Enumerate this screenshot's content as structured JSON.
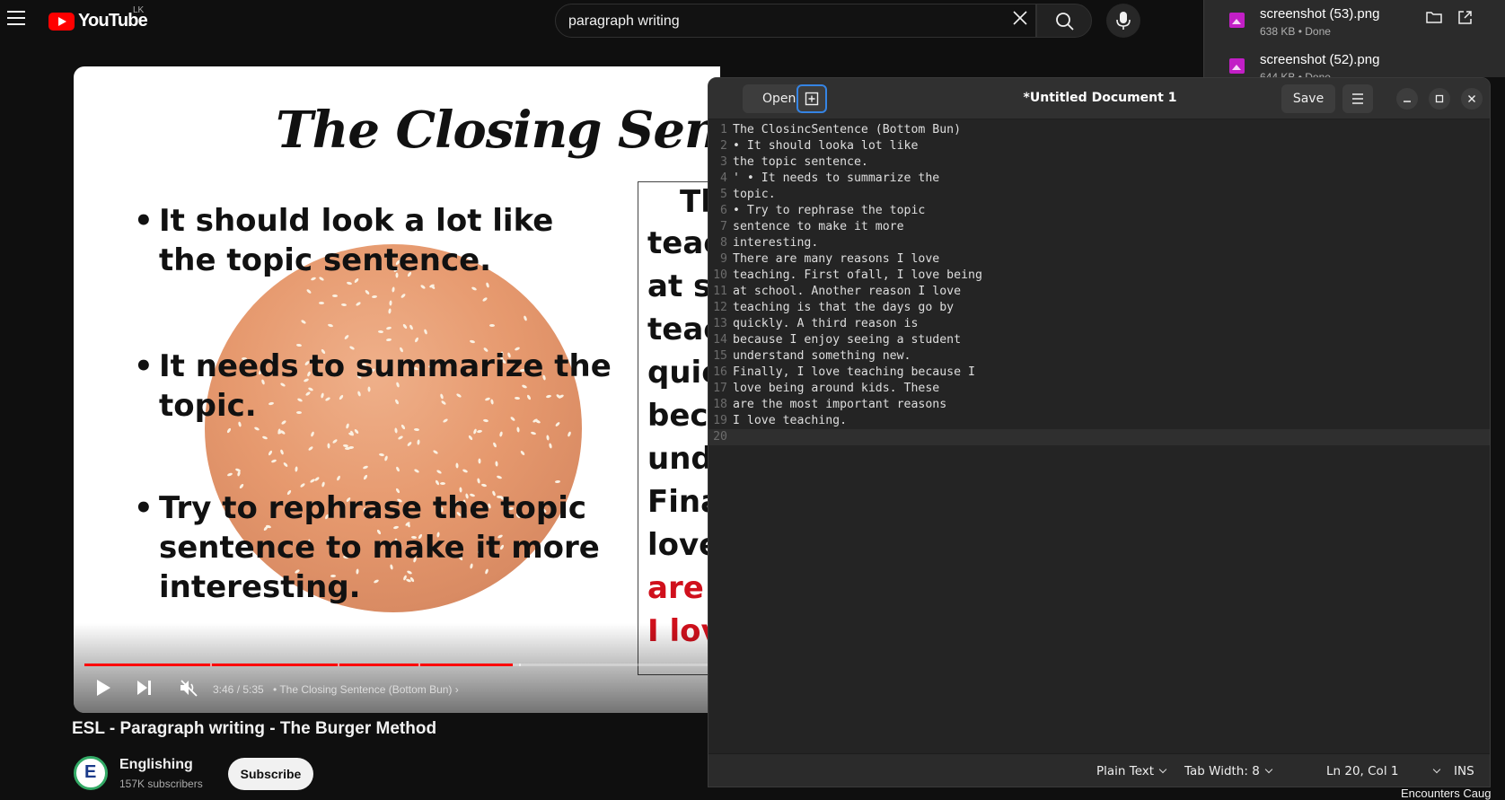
{
  "youtube": {
    "logo_text": "YouTube",
    "region": "LK",
    "search": {
      "value": "paragraph writing"
    },
    "video": {
      "title": "ESL - Paragraph writing - The Burger Method",
      "time": "3:46 / 5:35",
      "chapter": "• The Closing Sentence (Bottom Bun)",
      "progress_fraction": 0.674
    },
    "slide": {
      "title": "The Closing Sentenc",
      "bullets": [
        [
          "It should look a lot like",
          "the topic sentence."
        ],
        [
          "It needs to summarize the",
          "topic."
        ],
        [
          "Try to rephrase the topic",
          "sentence to make it more",
          "interesting."
        ]
      ],
      "side_lines": [
        {
          "text": "Th",
          "color": "black"
        },
        {
          "text": "teac",
          "color": "black"
        },
        {
          "text": "at sc",
          "color": "black"
        },
        {
          "text": "teac",
          "color": "black"
        },
        {
          "text": "quic",
          "color": "black"
        },
        {
          "text": "beca",
          "color": "black"
        },
        {
          "text": "unde",
          "color": "black"
        },
        {
          "text": "Fina",
          "color": "black"
        },
        {
          "text": "love",
          "color": "black"
        },
        {
          "text": "are t",
          "color": "red"
        },
        {
          "text": "I love",
          "color": "red"
        }
      ]
    },
    "channel": {
      "name": "Englishing",
      "subscribers": "157K subscribers",
      "subscribe_label": "Subscribe"
    },
    "rec_bottom_text": "Encounters Caug"
  },
  "downloads": [
    {
      "name": "screenshot (53).png",
      "meta": "638 KB • Done"
    },
    {
      "name": "screenshot (52).png",
      "meta": "644 KB • Done"
    }
  ],
  "gedit": {
    "open_label": "Open",
    "title": "*Untitled Document 1",
    "save_label": "Save",
    "lines": [
      "The ClosincSentence (Bottom Bun)",
      "• It should looka lot like",
      "the topic sentence.",
      "' • It needs to summarize the",
      "topic.",
      "• Try to rephrase the topic",
      "sentence to make it more",
      "interesting.",
      "There are many reasons I love",
      "teaching. First ofall, I love being",
      "at school. Another reason I love",
      "teaching is that the days go by",
      "quickly. A third reason is",
      "because I enjoy seeing a student",
      "understand something new.",
      "Finally, I love teaching because I",
      "love being around kids. These",
      "are the most important reasons",
      "I love teaching.",
      ""
    ],
    "current_line": 20,
    "status": {
      "language": "Plain Text",
      "tab_width": "Tab Width: 8",
      "position": "Ln 20, Col 1",
      "mode": "INS"
    }
  },
  "colors": {
    "youtube_red": "#ff0000",
    "slide_red": "#d0101c",
    "gedit_accent": "#3584e4"
  }
}
